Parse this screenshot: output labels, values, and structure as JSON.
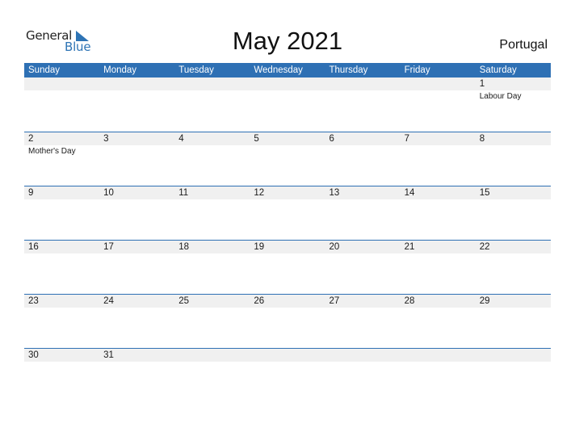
{
  "logo": {
    "line1": "General",
    "line2": "Blue",
    "icon": "triangle-flag-icon"
  },
  "title": "May 2021",
  "country": "Portugal",
  "colors": {
    "accent": "#2e70b4",
    "strip": "#f0f0f0"
  },
  "weekdays": [
    "Sunday",
    "Monday",
    "Tuesday",
    "Wednesday",
    "Thursday",
    "Friday",
    "Saturday"
  ],
  "weeks": [
    [
      {
        "day": "",
        "holiday": ""
      },
      {
        "day": "",
        "holiday": ""
      },
      {
        "day": "",
        "holiday": ""
      },
      {
        "day": "",
        "holiday": ""
      },
      {
        "day": "",
        "holiday": ""
      },
      {
        "day": "",
        "holiday": ""
      },
      {
        "day": "1",
        "holiday": "Labour Day"
      }
    ],
    [
      {
        "day": "2",
        "holiday": "Mother's Day"
      },
      {
        "day": "3",
        "holiday": ""
      },
      {
        "day": "4",
        "holiday": ""
      },
      {
        "day": "5",
        "holiday": ""
      },
      {
        "day": "6",
        "holiday": ""
      },
      {
        "day": "7",
        "holiday": ""
      },
      {
        "day": "8",
        "holiday": ""
      }
    ],
    [
      {
        "day": "9",
        "holiday": ""
      },
      {
        "day": "10",
        "holiday": ""
      },
      {
        "day": "11",
        "holiday": ""
      },
      {
        "day": "12",
        "holiday": ""
      },
      {
        "day": "13",
        "holiday": ""
      },
      {
        "day": "14",
        "holiday": ""
      },
      {
        "day": "15",
        "holiday": ""
      }
    ],
    [
      {
        "day": "16",
        "holiday": ""
      },
      {
        "day": "17",
        "holiday": ""
      },
      {
        "day": "18",
        "holiday": ""
      },
      {
        "day": "19",
        "holiday": ""
      },
      {
        "day": "20",
        "holiday": ""
      },
      {
        "day": "21",
        "holiday": ""
      },
      {
        "day": "22",
        "holiday": ""
      }
    ],
    [
      {
        "day": "23",
        "holiday": ""
      },
      {
        "day": "24",
        "holiday": ""
      },
      {
        "day": "25",
        "holiday": ""
      },
      {
        "day": "26",
        "holiday": ""
      },
      {
        "day": "27",
        "holiday": ""
      },
      {
        "day": "28",
        "holiday": ""
      },
      {
        "day": "29",
        "holiday": ""
      }
    ],
    [
      {
        "day": "30",
        "holiday": ""
      },
      {
        "day": "31",
        "holiday": ""
      },
      {
        "day": "",
        "holiday": ""
      },
      {
        "day": "",
        "holiday": ""
      },
      {
        "day": "",
        "holiday": ""
      },
      {
        "day": "",
        "holiday": ""
      },
      {
        "day": "",
        "holiday": ""
      }
    ]
  ]
}
